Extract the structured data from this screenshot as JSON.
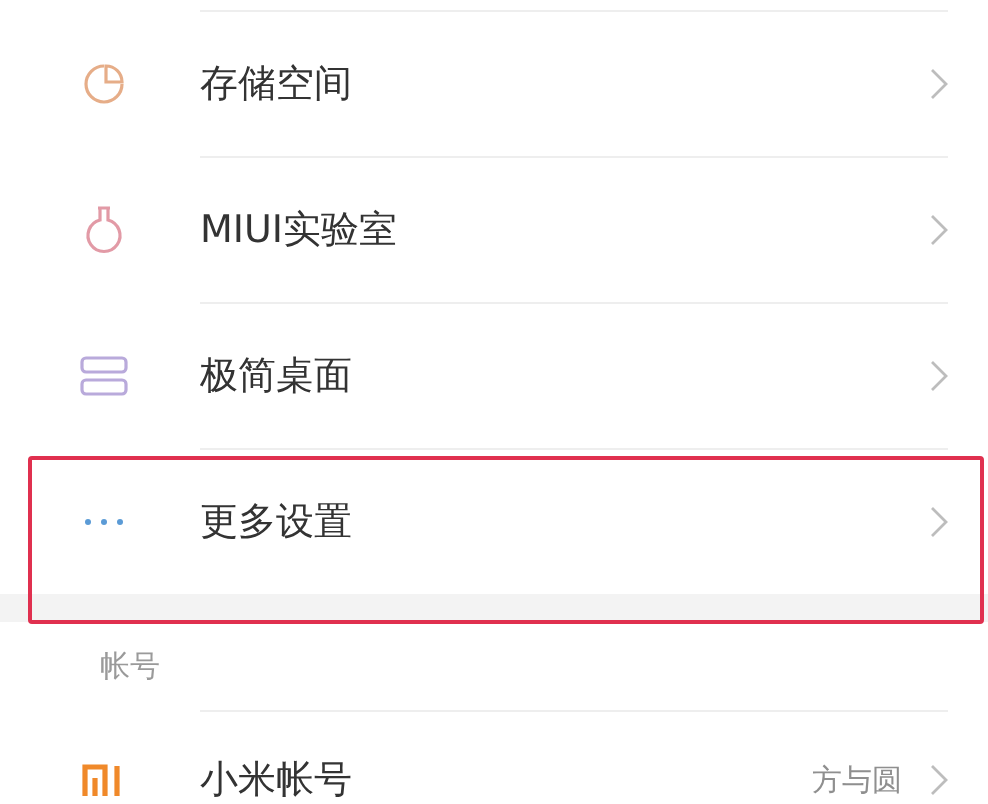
{
  "sections": [
    {
      "items": [
        {
          "kind": "storage",
          "label": "存储空间",
          "highlighted": false
        },
        {
          "kind": "lab",
          "label": "MIUI实验室",
          "highlighted": false
        },
        {
          "kind": "launcher",
          "label": "极简桌面",
          "highlighted": false
        },
        {
          "kind": "more",
          "label": "更多设置",
          "highlighted": true
        }
      ]
    },
    {
      "header": "帐号",
      "items": [
        {
          "kind": "mi",
          "label": "小米帐号",
          "value": "方与圆",
          "highlighted": false
        }
      ]
    }
  ]
}
